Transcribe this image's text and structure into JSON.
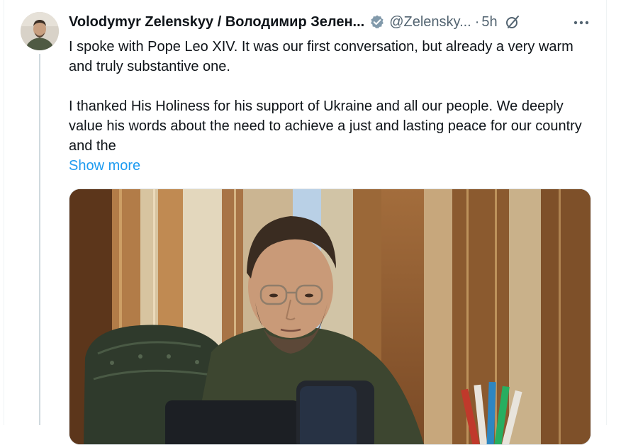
{
  "tweet": {
    "author_name": "Volodymyr Zelenskyy / Володимир Зелен...",
    "handle": "@Zelensky...",
    "separator": "·",
    "time": "5h",
    "paragraphs": [
      "I spoke with Pope Leo XIV. It was our first conversation, but already a very warm and truly substantive one.",
      "I thanked His Holiness for his support of Ukraine and all our people. We deeply value his words about the need to achieve a just and lasting peace for our country and the"
    ],
    "show_more": "Show more"
  },
  "colors": {
    "text": "#0f1419",
    "secondary": "#536471",
    "link": "#1d9bf0",
    "verified": "#829aab"
  },
  "icons": {
    "verified": "verified-badge-icon",
    "grok": "grok-icon",
    "more": "more-horizontal-icon"
  }
}
